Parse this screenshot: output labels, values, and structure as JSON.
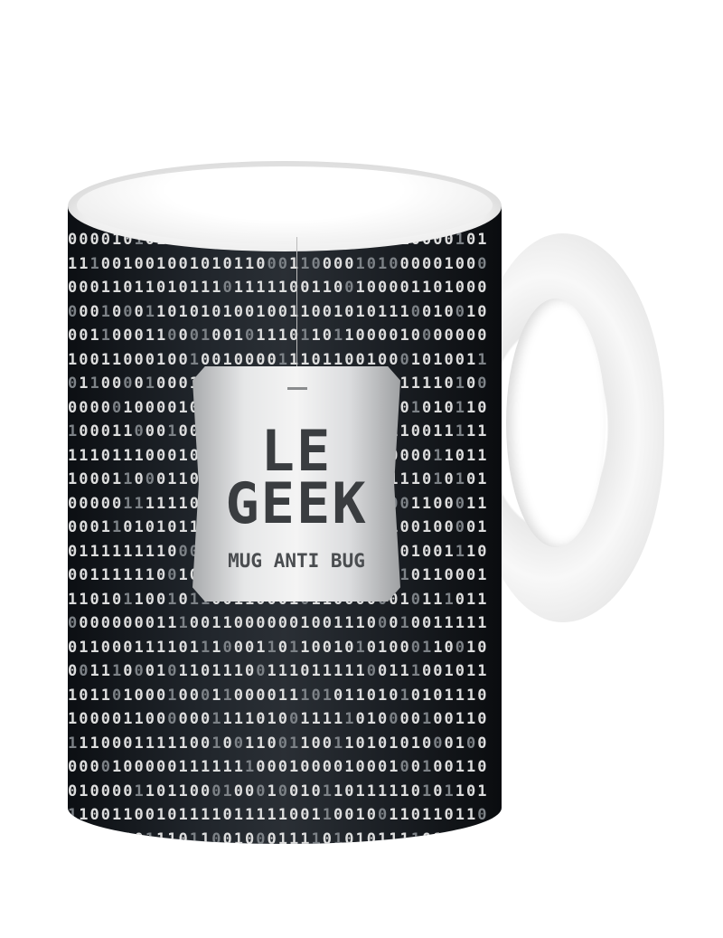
{
  "product": {
    "tag_title_line1": "LE",
    "tag_title_line2": "GEEK",
    "tag_subtitle": "MUG ANTI BUG"
  },
  "colors": {
    "mug_body": "#1f2429",
    "digit": "#e8e8e8",
    "digit_dim": "#7d8287",
    "tag": "#e6e7e8",
    "ceramic": "#ffffff"
  }
}
